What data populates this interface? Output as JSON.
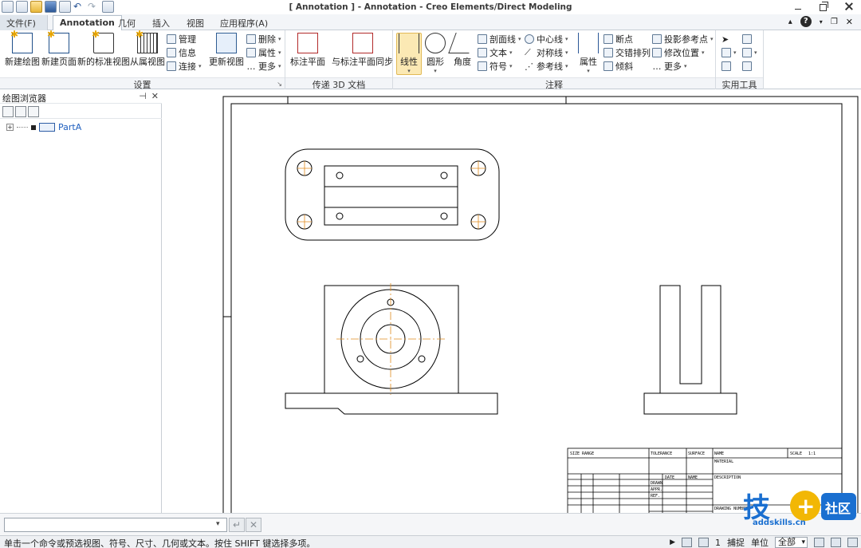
{
  "window": {
    "title": "[ Annotation ] - Annotation - Creo Elements/Direct Modeling"
  },
  "tabs": [
    "文件(F)",
    "Annotation",
    "几何",
    "插入",
    "视图",
    "应用程序(A)"
  ],
  "ribbon": {
    "setup": {
      "label": "设置",
      "new_drawing": "新建绘图",
      "new_page": "新建页面",
      "new_standard_view": "新的标准视图",
      "from_view": "从属视图",
      "manage": "管理",
      "info": "信息",
      "connect": "连接",
      "update_view": "更新视图",
      "delete": "删除",
      "properties": "属性",
      "more": "更多"
    },
    "transfer": {
      "label": "传递 3D 文档",
      "annotation_plane": "标注平面",
      "sync_plane": "与标注平面同步"
    },
    "annotation": {
      "label": "注释",
      "line_style": "线性",
      "circle": "圆形",
      "angle": "角度",
      "hatch": "剖面线",
      "text": "文本",
      "symbol": "符号",
      "center_line": "中心线",
      "symmetry_line": "对称线",
      "reference_line": "参考线",
      "properties": "属性",
      "break_point": "断点",
      "staggered": "交错排列",
      "tilt": "倾斜",
      "projected_ref_point": "投影参考点",
      "modify_position": "修改位置",
      "more": "更多"
    },
    "utilities": {
      "label": "实用工具"
    }
  },
  "browser": {
    "title": "绘图浏览器",
    "tree": [
      {
        "label": "PartA"
      }
    ]
  },
  "canvas": {
    "title_block": {
      "size_range": "SIZE RANGE",
      "tolerance": "TOLERANCE",
      "surface": "SURFACE",
      "name": "NAME",
      "scale": "SCALE",
      "scale_value": "1:1",
      "material": "MATERIAL",
      "date": "DATE",
      "name2": "NAME",
      "description": "DESCRIPTION",
      "drawn": "DRAWN",
      "appr": "APPR.",
      "ref": "REF.",
      "drawing_number": "DRAWING NUMBER"
    }
  },
  "command": {
    "input_value": ""
  },
  "status": {
    "message": "单击一个命令或预选视图、符号、尺寸、几何或文本。按住 SHIFT 键选择多项。",
    "count": "1",
    "snap": "捕捉",
    "unit": "单位",
    "filter": "全部"
  },
  "watermark": {
    "brand_text": "技",
    "badge": "社区",
    "domain": "addskills.cn"
  },
  "colors": {
    "accent": "#2b5797",
    "selection": "#fbe9b4",
    "centerline": "#e08a1c"
  }
}
